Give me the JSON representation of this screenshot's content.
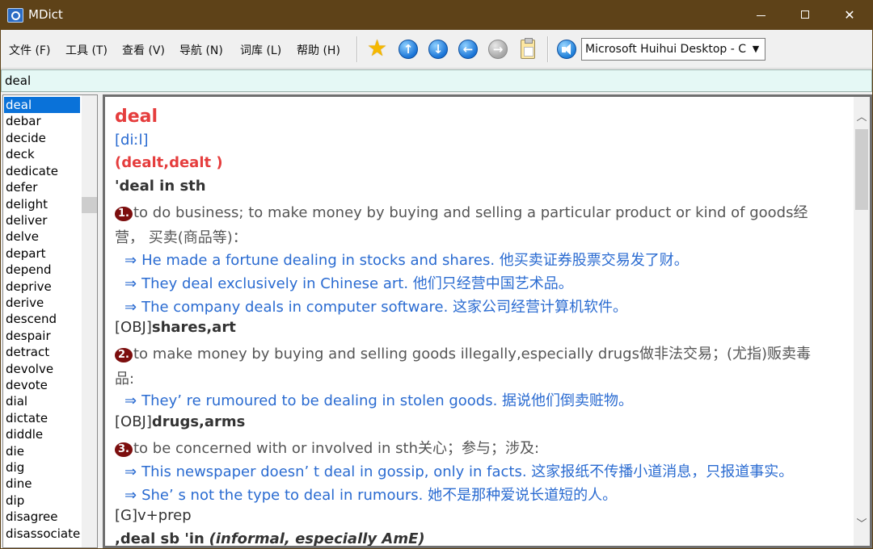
{
  "window": {
    "title": "MDict",
    "minimize": "—",
    "maximize": "",
    "close": "✕"
  },
  "menu": {
    "file": "文件 (F)",
    "tools": "工具 (T)",
    "view": "查看 (V)",
    "navigate": "导航 (N)",
    "library": "词库 (L)",
    "help": "帮助 (H)"
  },
  "toolbar": {
    "icons": [
      "star-icon",
      "arrow-up-icon",
      "arrow-down-icon",
      "arrow-left-icon",
      "arrow-right-icon",
      "clipboard-icon",
      "speaker-icon"
    ],
    "up": "↑",
    "down": "↓",
    "back": "←",
    "forward": "→",
    "voice_selected": "Microsoft Huihui Desktop - C",
    "voice_arrow": "▼"
  },
  "search": {
    "value": "deal"
  },
  "wordlist": {
    "items": [
      "deal",
      "debar",
      "decide",
      "deck",
      "dedicate",
      "defer",
      "delight",
      "deliver",
      "delve",
      "depart",
      "depend",
      "deprive",
      "derive",
      "descend",
      "despair",
      "detract",
      "devolve",
      "devote",
      "dial",
      "dictate",
      "diddle",
      "die",
      "dig",
      "dine",
      "dip",
      "disagree",
      "disassociate"
    ],
    "selected": "deal"
  },
  "entry": {
    "headword": "deal",
    "phonetic": "[diːl]",
    "forms": "(dealt,dealt )",
    "phrase1": "'deal in sth",
    "sense1_num": "1.",
    "sense1_text": "to do business; to make money by buying and selling a particular product or kind of goods经",
    "sense1_cont": "营， 买卖(商品等)：",
    "examples1": [
      "He made a fortune dealing in stocks and shares.  他买卖证券股票交易发了财。",
      "They deal exclusively in Chinese art.  他们只经营中国艺术品。",
      "The company deals in computer software.  这家公司经营计算机软件。"
    ],
    "pattern1_tag": "[OBJ]",
    "pattern1_words": "shares,art",
    "sense2_num": "2.",
    "sense2_text": "to make money by buying and selling goods illegally,especially drugs做非法交易；(尤指)贩卖毒",
    "sense2_cont": "品:",
    "examples2": [
      "They’ re rumoured to be dealing in stolen goods.  据说他们倒卖赃物。"
    ],
    "pattern2_tag": "[OBJ]",
    "pattern2_words": "drugs,arms",
    "sense3_num": "3.",
    "sense3_text": "to be concerned with or involved in sth关心；参与；涉及:",
    "examples3": [
      "This newspaper doesn’ t deal in gossip, only in facts.  这家报纸不传播小道消息，只报道事实。",
      "She’ s not the type to deal in rumours.  她不是那种爱说长道短的人。"
    ],
    "grammar": "[G]v+prep",
    "phrase2": ",deal sb 'in",
    "phrase2_note": "(informal, especially AmE)",
    "example_arrow": "⇒"
  },
  "scroll": {
    "up": "︿",
    "down": "﹀"
  }
}
